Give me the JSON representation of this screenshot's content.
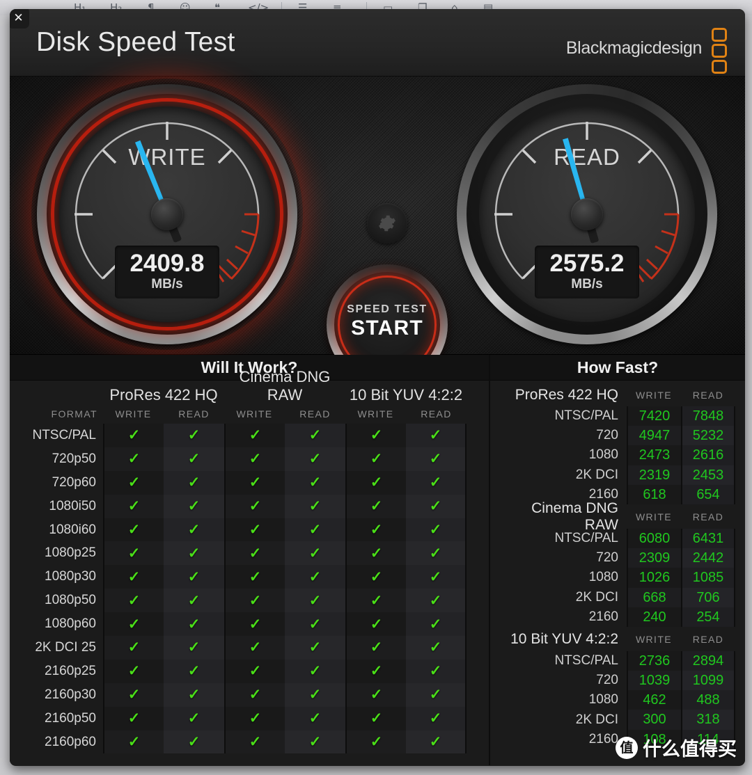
{
  "window": {
    "close_label": "✕",
    "title": "Disk Speed Test",
    "brand": "Blackmagicdesign"
  },
  "gauges": {
    "write": {
      "label": "WRITE",
      "value": "2409.8",
      "unit": "MB/s",
      "needle_deg": -22,
      "highlighted": true
    },
    "read": {
      "label": "READ",
      "value": "2575.2",
      "unit": "MB/s",
      "needle_deg": -16,
      "highlighted": false
    }
  },
  "start_button": {
    "small": "SPEED TEST",
    "big": "START"
  },
  "settings_icon": "gear-icon",
  "will_it_work": {
    "title": "Will It Work?",
    "format_header": "FORMAT",
    "groups": [
      "ProRes 422 HQ",
      "Cinema DNG RAW",
      "10 Bit YUV 4:2:2"
    ],
    "subcolumns": [
      "WRITE",
      "READ"
    ],
    "formats": [
      "NTSC/PAL",
      "720p50",
      "720p60",
      "1080i50",
      "1080i60",
      "1080p25",
      "1080p30",
      "1080p50",
      "1080p60",
      "2K DCI 25",
      "2160p25",
      "2160p30",
      "2160p50",
      "2160p60"
    ],
    "check_glyph": "✓",
    "rows": [
      [
        "✓",
        "✓",
        "✓",
        "✓",
        "✓",
        "✓"
      ],
      [
        "✓",
        "✓",
        "✓",
        "✓",
        "✓",
        "✓"
      ],
      [
        "✓",
        "✓",
        "✓",
        "✓",
        "✓",
        "✓"
      ],
      [
        "✓",
        "✓",
        "✓",
        "✓",
        "✓",
        "✓"
      ],
      [
        "✓",
        "✓",
        "✓",
        "✓",
        "✓",
        "✓"
      ],
      [
        "✓",
        "✓",
        "✓",
        "✓",
        "✓",
        "✓"
      ],
      [
        "✓",
        "✓",
        "✓",
        "✓",
        "✓",
        "✓"
      ],
      [
        "✓",
        "✓",
        "✓",
        "✓",
        "✓",
        "✓"
      ],
      [
        "✓",
        "✓",
        "✓",
        "✓",
        "✓",
        "✓"
      ],
      [
        "✓",
        "✓",
        "✓",
        "✓",
        "✓",
        "✓"
      ],
      [
        "✓",
        "✓",
        "✓",
        "✓",
        "✓",
        "✓"
      ],
      [
        "✓",
        "✓",
        "✓",
        "✓",
        "✓",
        "✓"
      ],
      [
        "✓",
        "✓",
        "✓",
        "✓",
        "✓",
        "✓"
      ],
      [
        "✓",
        "✓",
        "✓",
        "✓",
        "✓",
        "✓"
      ]
    ]
  },
  "how_fast": {
    "title": "How Fast?",
    "subcolumns": [
      "WRITE",
      "READ"
    ],
    "groups": [
      {
        "name": "ProRes 422 HQ",
        "rows": [
          {
            "label": "NTSC/PAL",
            "write": "7420",
            "read": "7848"
          },
          {
            "label": "720",
            "write": "4947",
            "read": "5232"
          },
          {
            "label": "1080",
            "write": "2473",
            "read": "2616"
          },
          {
            "label": "2K DCI",
            "write": "2319",
            "read": "2453"
          },
          {
            "label": "2160",
            "write": "618",
            "read": "654"
          }
        ]
      },
      {
        "name": "Cinema DNG RAW",
        "rows": [
          {
            "label": "NTSC/PAL",
            "write": "6080",
            "read": "6431"
          },
          {
            "label": "720",
            "write": "2309",
            "read": "2442"
          },
          {
            "label": "1080",
            "write": "1026",
            "read": "1085"
          },
          {
            "label": "2K DCI",
            "write": "668",
            "read": "706"
          },
          {
            "label": "2160",
            "write": "240",
            "read": "254"
          }
        ]
      },
      {
        "name": "10 Bit YUV 4:2:2",
        "rows": [
          {
            "label": "NTSC/PAL",
            "write": "2736",
            "read": "2894"
          },
          {
            "label": "720",
            "write": "1039",
            "read": "1099"
          },
          {
            "label": "1080",
            "write": "462",
            "read": "488"
          },
          {
            "label": "2K DCI",
            "write": "300",
            "read": "318"
          },
          {
            "label": "2160",
            "write": "108",
            "read": "114"
          }
        ]
      }
    ]
  },
  "watermark": {
    "badge": "值",
    "text": "什么值得买"
  },
  "colors": {
    "check_green": "#4ade18",
    "value_green": "#20c71f",
    "accent_red": "#d42c14",
    "needle_blue": "#29b6f0",
    "brand_orange": "#e08214"
  }
}
